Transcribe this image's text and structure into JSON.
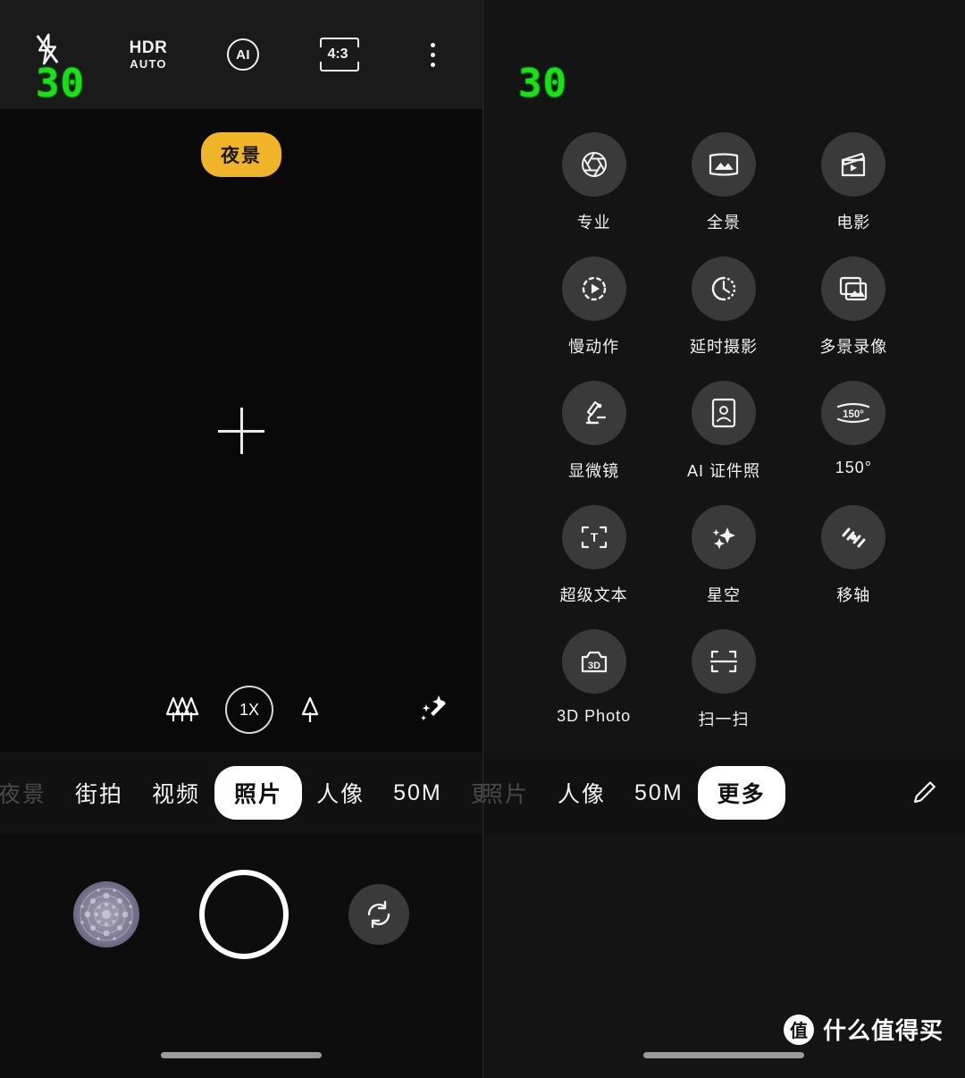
{
  "left_screen": {
    "fps_overlay": "30",
    "topbar": {
      "flash_icon": "flash-off-icon",
      "hdr_label": "HDR",
      "hdr_mode": "AUTO",
      "ai_label": "AI",
      "aspect_ratio": "4:3",
      "more_icon": "kebab-menu-icon"
    },
    "preview": {
      "scene_badge": "夜景",
      "focus_marker": "crosshair-icon"
    },
    "zoom": {
      "ultrawide_icon": "three-trees-icon",
      "current": "1X",
      "tele_icon": "single-tree-icon",
      "filters_icon": "magic-wand-icon"
    },
    "modes": [
      {
        "label": "夜景",
        "selected": false,
        "dim": true
      },
      {
        "label": "街拍",
        "selected": false,
        "dim": false
      },
      {
        "label": "视频",
        "selected": false,
        "dim": false
      },
      {
        "label": "照片",
        "selected": true,
        "dim": false
      },
      {
        "label": "人像",
        "selected": false,
        "dim": false
      },
      {
        "label": "50M",
        "selected": false,
        "dim": false
      },
      {
        "label": "更多",
        "selected": false,
        "dim": true
      }
    ],
    "controls": {
      "gallery_icon": "gallery-thumbnail",
      "shutter_icon": "shutter-button",
      "flip_icon": "camera-flip-icon"
    }
  },
  "right_screen": {
    "fps_overlay": "30",
    "mode_grid": [
      {
        "label": "专业",
        "icon": "aperture-icon"
      },
      {
        "label": "全景",
        "icon": "panorama-icon"
      },
      {
        "label": "电影",
        "icon": "clapperboard-icon"
      },
      {
        "label": "慢动作",
        "icon": "slow-motion-icon"
      },
      {
        "label": "延时摄影",
        "icon": "timelapse-clock-icon"
      },
      {
        "label": "多景录像",
        "icon": "multi-scene-video-icon"
      },
      {
        "label": "显微镜",
        "icon": "microscope-icon"
      },
      {
        "label": "AI 证件照",
        "icon": "id-photo-icon"
      },
      {
        "label": "150°",
        "icon": "wide-angle-150-icon"
      },
      {
        "label": "超级文本",
        "icon": "super-text-icon"
      },
      {
        "label": "星空",
        "icon": "starry-sky-icon"
      },
      {
        "label": "移轴",
        "icon": "tilt-shift-icon"
      },
      {
        "label": "3D Photo",
        "icon": "3d-photo-icon"
      },
      {
        "label": "扫一扫",
        "icon": "scan-icon"
      }
    ],
    "modes": [
      {
        "label": "照片",
        "selected": false,
        "dim": true
      },
      {
        "label": "人像",
        "selected": false,
        "dim": false
      },
      {
        "label": "50M",
        "selected": false,
        "dim": false
      },
      {
        "label": "更多",
        "selected": true,
        "dim": false
      }
    ],
    "edit_icon": "pencil-edit-icon"
  },
  "watermark": {
    "logo": "值",
    "text": "什么值得买"
  },
  "colors": {
    "accent_scene_badge": "#f0b429",
    "fps_green": "#19e019",
    "selected_pill": "#ffffff",
    "icon_circle": "#3a3a3a",
    "panel_left_bg": "#0d0d0d",
    "panel_right_bg": "#141414"
  }
}
